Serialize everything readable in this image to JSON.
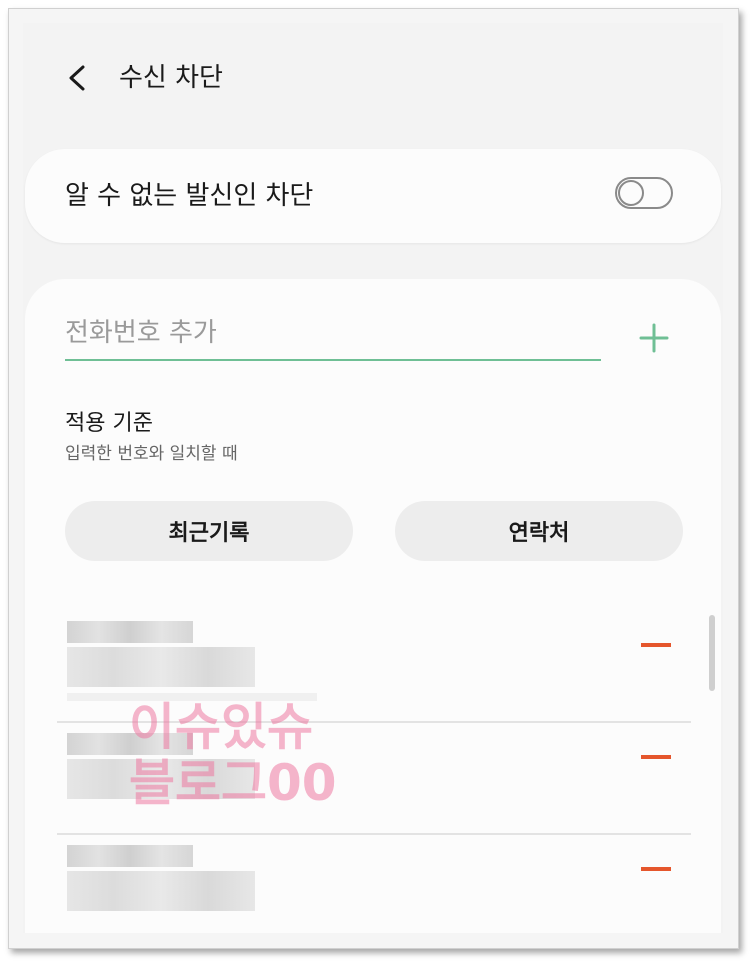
{
  "header": {
    "title": "수신 차단"
  },
  "unknown_caller": {
    "label": "알 수 없는 발신인 차단",
    "toggle_state": "off"
  },
  "phone_input": {
    "placeholder": "전화번호 추가",
    "value": ""
  },
  "criteria": {
    "title": "적용 기준",
    "subtitle": "입력한 번호와 일치할 때"
  },
  "buttons": {
    "recent": "최근기록",
    "contacts": "연락처"
  },
  "blocked_numbers": [
    {
      "number": ""
    },
    {
      "number": ""
    },
    {
      "number": ""
    }
  ],
  "watermark": {
    "line1": "이슈있슈",
    "line2": "블로그00"
  },
  "colors": {
    "accent": "#6fbf95",
    "remove": "#e5562c"
  }
}
